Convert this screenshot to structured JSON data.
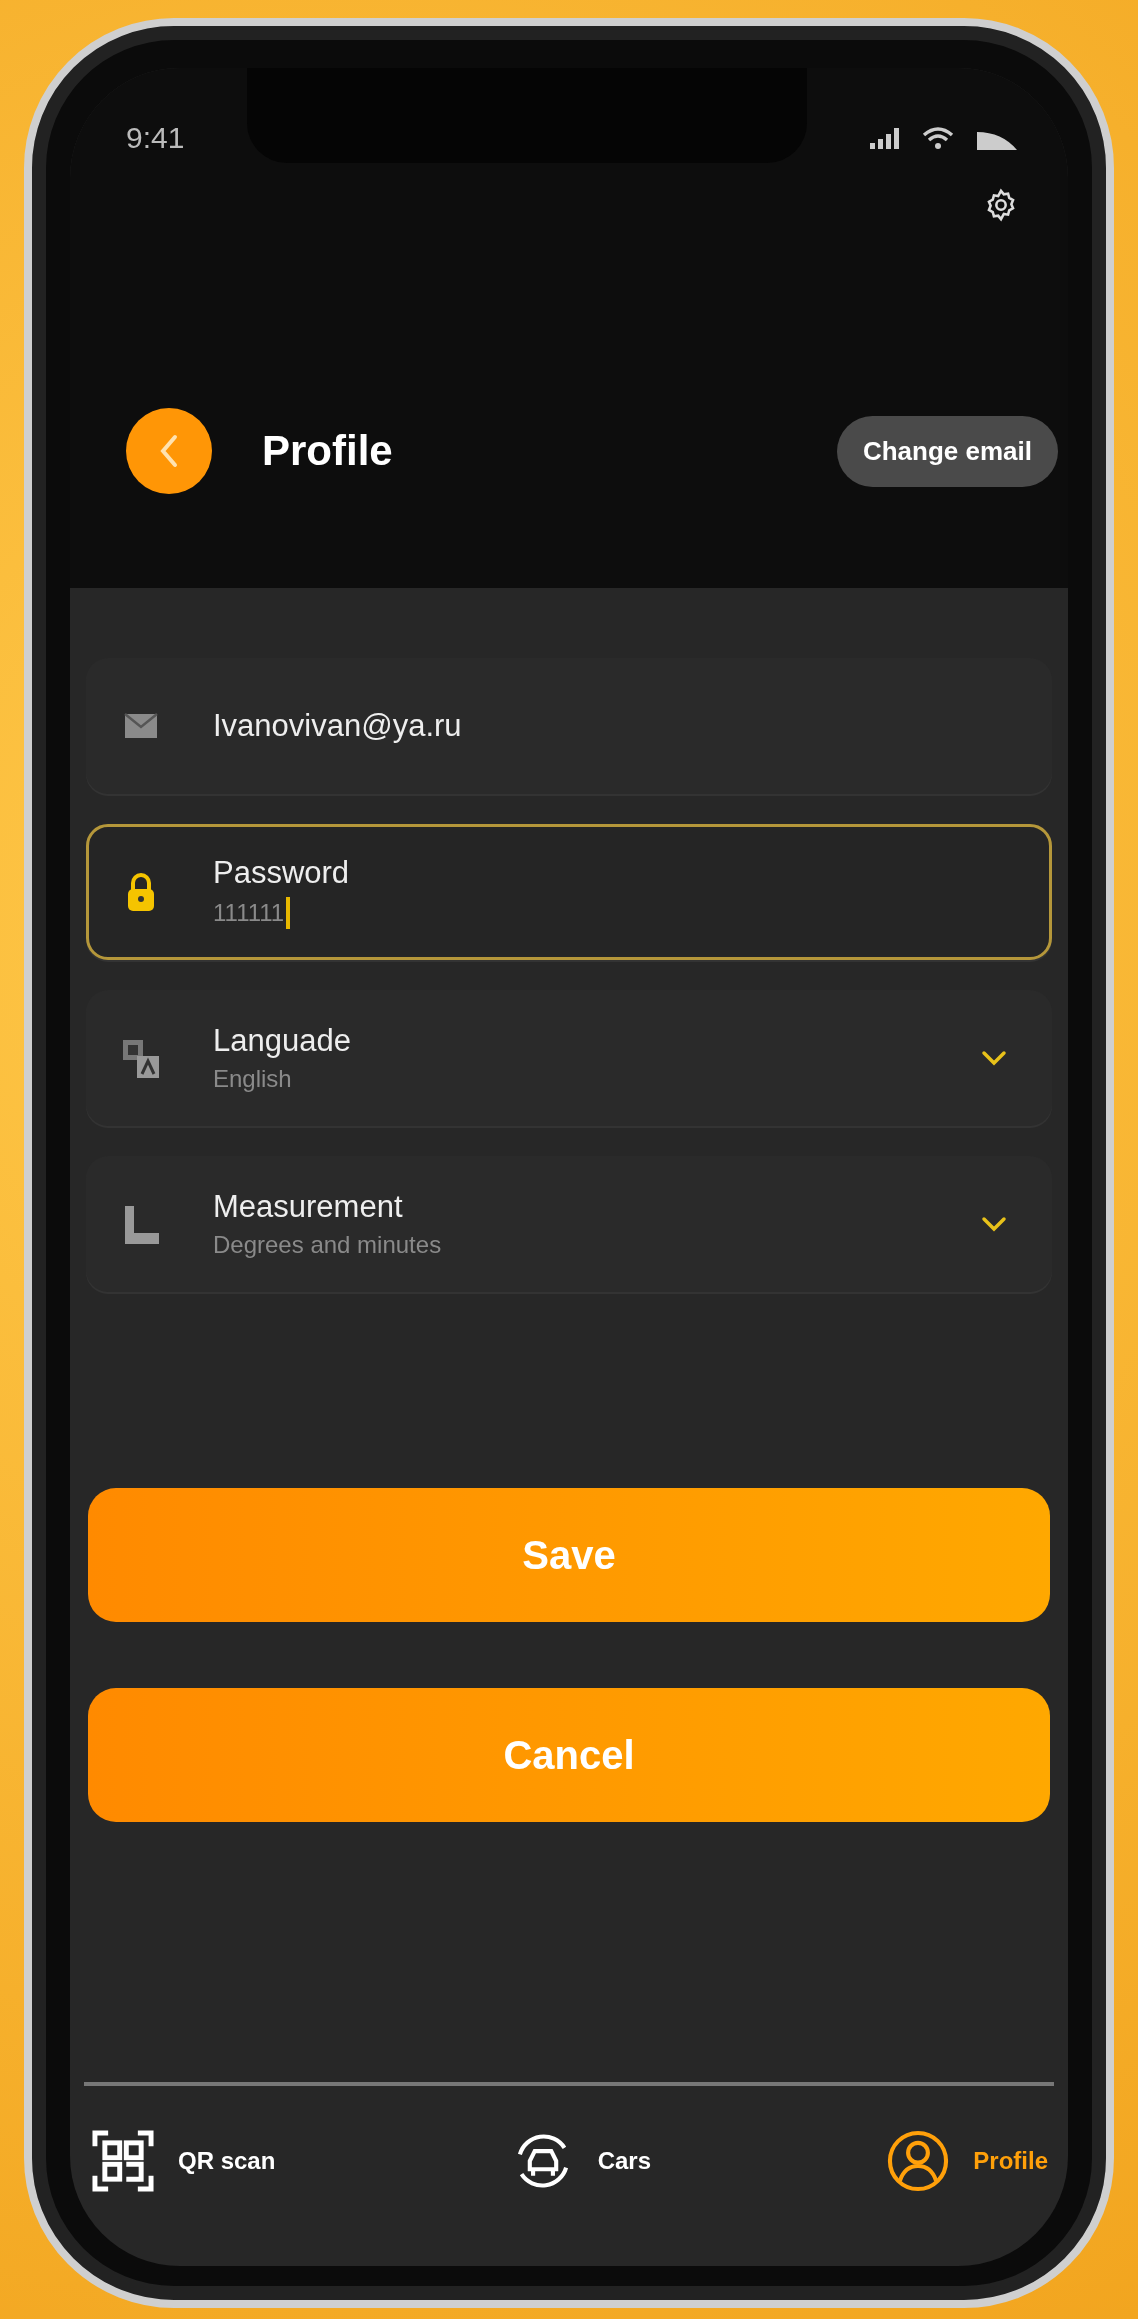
{
  "status_bar": {
    "time": "9:41"
  },
  "header": {
    "title": "Profile",
    "action": "Change email"
  },
  "fields": [
    {
      "kind": "email",
      "value": "Ivanovivan@ya.ru",
      "focused": false
    },
    {
      "kind": "password",
      "label": "Password",
      "value": "111111",
      "focused": true
    },
    {
      "kind": "language",
      "label": "Languade",
      "value": "English",
      "focused": false
    },
    {
      "kind": "measurement",
      "label": "Measurement",
      "value": "Degrees and minutes",
      "focused": false
    }
  ],
  "buttons": [
    "Save",
    "Cancel"
  ],
  "nav": [
    {
      "kind": "qr",
      "label": "QR scan",
      "selected": false
    },
    {
      "kind": "cars",
      "label": "Cars",
      "selected": false
    },
    {
      "kind": "profile",
      "label": "Profile",
      "selected": true
    }
  ]
}
